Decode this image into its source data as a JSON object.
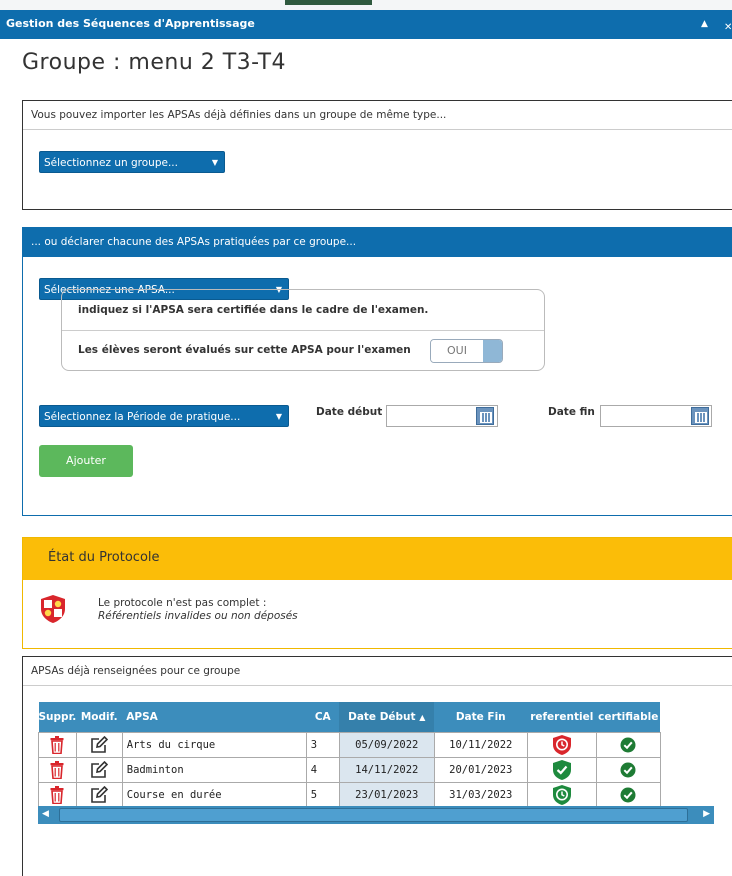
{
  "window": {
    "title": "Gestion des Séquences d'Apprentissage"
  },
  "page": {
    "title": "Groupe : menu 2 T3-T4"
  },
  "import_panel": {
    "header": "Vous pouvez importer les APSAs déjà définies dans un groupe de même type...",
    "group_select": "Sélectionnez un groupe..."
  },
  "declare_panel": {
    "header": "... ou déclarer chacune des APSAs pratiquées par ce groupe...",
    "apsa_select": "Sélectionnez une APSA...",
    "cert_info": "indiquez si l'APSA sera certifiée dans le cadre de l'examen.",
    "cert_question": "Les élèves seront évalués sur cette APSA pour l'examen",
    "cert_toggle": "OUI",
    "period_select": "Sélectionnez la Période de pratique...",
    "date_start_label": "Date début",
    "date_end_label": "Date fin",
    "add_button": "Ajouter"
  },
  "protocol": {
    "header": "État du Protocole",
    "status": "Le protocole n'est pas complet :",
    "detail": "Référentiels invalides ou non déposés"
  },
  "apsa_table": {
    "header": "APSAs déjà renseignées pour ce groupe",
    "columns": [
      "Suppr.",
      "Modif.",
      "APSA",
      "CA",
      "Date Début",
      "Date Fin",
      "referentiel",
      "certifiable"
    ],
    "rows": [
      {
        "apsa": "Arts du cirque",
        "ca": "3",
        "date_debut": "05/09/2022",
        "date_fin": "10/11/2022",
        "referentiel": "red-clock-shield-icon",
        "certifiable": "check-icon"
      },
      {
        "apsa": "Badminton",
        "ca": "4",
        "date_debut": "14/11/2022",
        "date_fin": "20/01/2023",
        "referentiel": "green-check-shield-icon",
        "certifiable": "check-icon"
      },
      {
        "apsa": "Course en durée",
        "ca": "5",
        "date_debut": "23/01/2023",
        "date_fin": "31/03/2023",
        "referentiel": "green-clock-shield-icon",
        "certifiable": "check-icon"
      }
    ]
  },
  "colors": {
    "primary": "#0e6dad",
    "success": "#5cb85c",
    "warning": "#fbbd08",
    "danger": "#d9262c",
    "table_header": "#3c8dbc"
  }
}
